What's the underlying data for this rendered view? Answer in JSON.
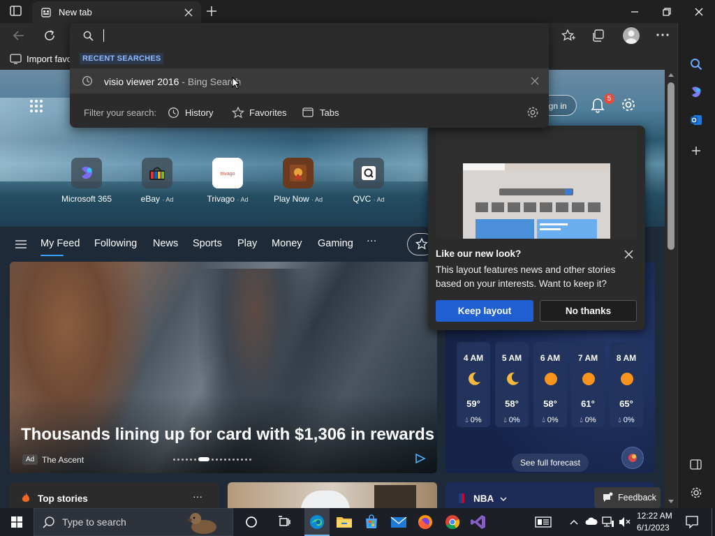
{
  "browser": {
    "tab_title": "New tab",
    "favorites_bar_item": "Import favo"
  },
  "omnibox": {
    "recent_searches_label": "RECENT SEARCHES",
    "suggestion_query": "visio viewer 2016",
    "suggestion_suffix": " - Bing Search",
    "filter_label": "Filter your search:",
    "filters": [
      "History",
      "Favorites",
      "Tabs"
    ]
  },
  "header": {
    "sign_in": "Sign in",
    "notification_count": "5"
  },
  "quick_links": [
    {
      "label": "Microsoft 365",
      "ad": ""
    },
    {
      "label": "eBay",
      "ad": "· Ad"
    },
    {
      "label": "Trivago",
      "ad": "· Ad"
    },
    {
      "label": "Play Now",
      "ad": "· Ad"
    },
    {
      "label": "QVC",
      "ad": "· Ad"
    }
  ],
  "nav": {
    "items": [
      "My Feed",
      "Following",
      "News",
      "Sports",
      "Play",
      "Money",
      "Gaming"
    ],
    "more": "···",
    "active_index": 0
  },
  "feature": {
    "title": "Thousands lining up for card with $1,306 in rewards",
    "ad_badge": "Ad",
    "source": "The Ascent"
  },
  "popup": {
    "title": "Like our new look?",
    "body": "This layout features news and other stories based on your interests. Want to keep it?",
    "keep_label": "Keep layout",
    "decline_label": "No thanks"
  },
  "weather": {
    "hours": [
      {
        "time": "4 AM",
        "icon": "moon-icon",
        "temp": "59°",
        "precip": "0%"
      },
      {
        "time": "5 AM",
        "icon": "moon-icon",
        "temp": "58°",
        "precip": "0%"
      },
      {
        "time": "6 AM",
        "icon": "sun-icon",
        "temp": "58°",
        "precip": "0%"
      },
      {
        "time": "7 AM",
        "icon": "sun-icon",
        "temp": "61°",
        "precip": "0%"
      },
      {
        "time": "8 AM",
        "icon": "sun-icon",
        "temp": "65°",
        "precip": "0%"
      }
    ],
    "see_full": "See full forecast"
  },
  "cards": {
    "top_stories": "Top stories",
    "top_stories_more": "···",
    "nba": "NBA"
  },
  "feedback": "Feedback",
  "taskbar": {
    "search_placeholder": "Type to search",
    "time": "12:22 AM",
    "date": "6/1/2023"
  },
  "colors": {
    "accent": "#1f5fd1",
    "nav_underline": "#3aa0ff",
    "notification_badge": "#e74c3c"
  }
}
